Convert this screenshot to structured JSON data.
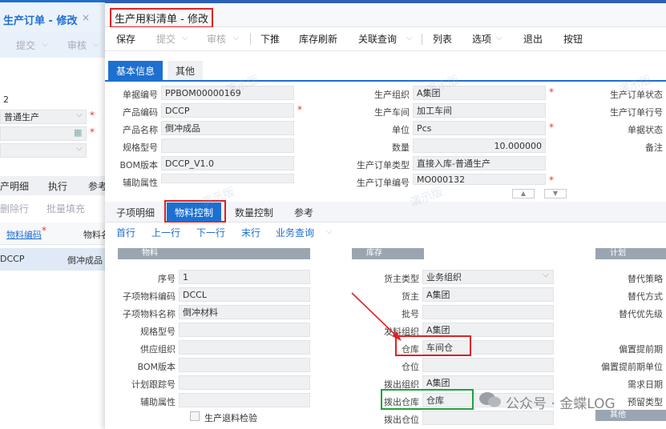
{
  "back_window": {
    "tab_title": "生产订单 - 修改",
    "tab_close": "×",
    "toolbar": [
      "提交",
      "审核"
    ],
    "field_value_1": "2",
    "field_value_2": "普通生产",
    "tabs": [
      "产明细",
      "执行",
      "参考"
    ],
    "actions": [
      "删除行",
      "批量填充"
    ],
    "col_headers": [
      "物料编码",
      "物料名"
    ],
    "row_code": "DCCP",
    "row_name": "倒冲成品"
  },
  "front_window": {
    "title": "生产用料清单 - 修改",
    "toolbar": {
      "save": "保存",
      "submit": "提交",
      "audit": "审核",
      "push": "下推",
      "refresh": "库存刷新",
      "query": "关联查询",
      "list": "列表",
      "options": "选项",
      "exit": "退出",
      "button": "按钮"
    },
    "header_tabs": [
      "基本信息",
      "其他"
    ],
    "header_fields": {
      "doc_no_label": "单据编号",
      "doc_no": "PPBOM00000169",
      "mat_code_label": "产品编码",
      "mat_code": "DCCP",
      "mat_name_label": "产品名称",
      "mat_name": "倒冲成品",
      "spec_label": "规格型号",
      "bom_label": "BOM版本",
      "bom": "DCCP_V1.0",
      "aux_label": "辅助属性",
      "org_label": "生产组织",
      "org": "A集团",
      "workshop_label": "生产车间",
      "workshop": "加工车间",
      "unit_label": "单位",
      "unit": "Pcs",
      "qty_label": "数量",
      "qty": "10.000000",
      "order_type_label": "生产订单类型",
      "order_type": "直接入库-普通生产",
      "order_no_label": "生产订单编号",
      "order_no": "MO000132",
      "order_status_label": "生产订单状态",
      "order_line_label": "生产订单行号",
      "doc_status_label": "单据状态",
      "remark_label": "备注"
    },
    "detail_tabs": [
      "子项明细",
      "物料控制",
      "数量控制",
      "参考"
    ],
    "nav": [
      "首行",
      "上一行",
      "下一行",
      "末行",
      "业务查询"
    ],
    "sections": {
      "material": "物料",
      "stock": "库存",
      "plan": "计划",
      "other": "其他"
    },
    "material_fields": {
      "seq_label": "序号",
      "seq": "1",
      "code_label": "子项物料编码",
      "code": "DCCL",
      "name_label": "子项物料名称",
      "name": "倒冲材料",
      "spec_label": "规格型号",
      "supply_org_label": "供应组织",
      "bom_label": "BOM版本",
      "track_label": "计划跟踪号",
      "aux_label": "辅助属性",
      "return_check": "生产退料检验"
    },
    "stock_fields": {
      "owner_type_label": "货主类型",
      "owner_type": "业务组织",
      "owner_label": "货主",
      "owner": "A集团",
      "lot_label": "批号",
      "issue_org_label": "发料组织",
      "issue_org": "A集团",
      "wh_label": "仓库",
      "wh": "车间仓",
      "loc_label": "仓位",
      "out_org_label": "拨出组织",
      "out_org": "A集团",
      "out_wh_label": "拨出仓库",
      "out_wh": "仓库",
      "out_loc_label": "拨出仓位"
    },
    "plan_fields": [
      "替代策略",
      "替代方式",
      "替代优先级",
      "偏置提前期",
      "偏置提前期单位",
      "需求日期",
      "预留类型"
    ],
    "watermark": "演示版"
  },
  "wechat_watermark": "公众号 · 金蝶LOG",
  "colors": {
    "accent": "#1e6fd0",
    "highlight_red": "#e02020",
    "highlight_green": "#20a040"
  }
}
